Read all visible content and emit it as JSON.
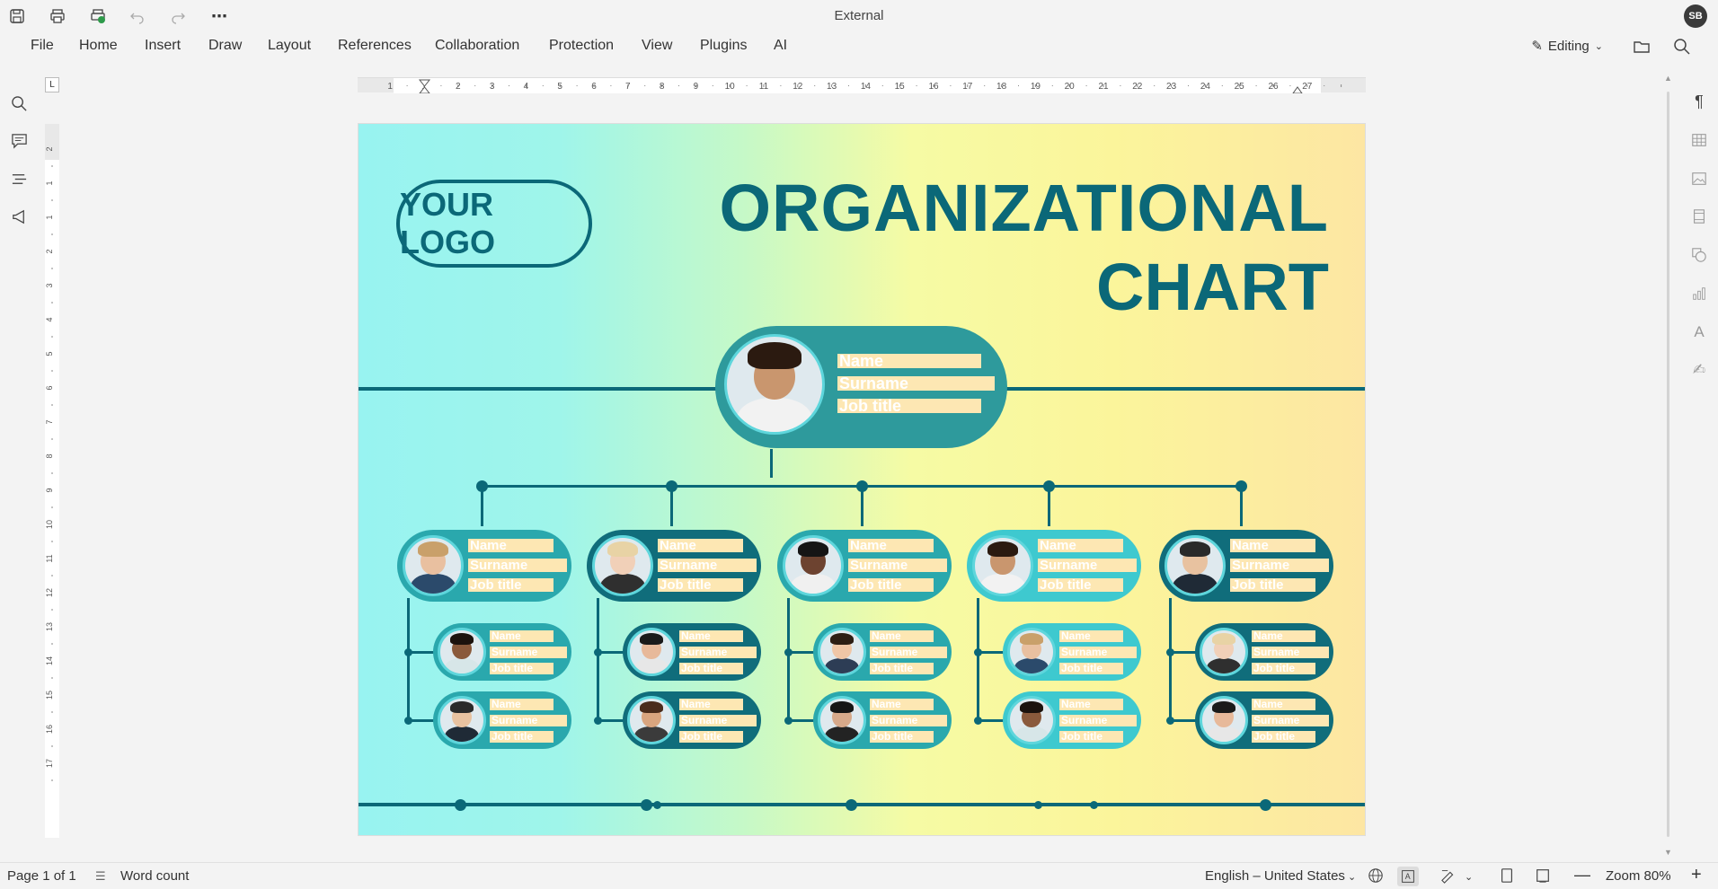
{
  "window": {
    "title": "External",
    "user_initials": "SB"
  },
  "menu": [
    "File",
    "Home",
    "Insert",
    "Draw",
    "Layout",
    "References",
    "Collaboration",
    "Protection",
    "View",
    "Plugins",
    "AI"
  ],
  "editing_mode": "Editing",
  "ruler": {
    "h_labels": [
      "1",
      "1",
      "2",
      "3",
      "4",
      "5",
      "6",
      "7",
      "8",
      "9",
      "10",
      "11",
      "12",
      "13",
      "14",
      "15",
      "16",
      "17",
      "18",
      "19",
      "20",
      "21",
      "22",
      "23",
      "24",
      "25",
      "26",
      "27"
    ],
    "v_labels": [
      "2",
      "1",
      "1",
      "2",
      "3",
      "4",
      "5",
      "6",
      "7",
      "8",
      "9",
      "10",
      "11",
      "12",
      "13",
      "14",
      "15",
      "16",
      "17"
    ],
    "corner": "L"
  },
  "document": {
    "logo_text": "YOUR LOGO",
    "title_line1": "ORGANIZATIONAL",
    "title_line2": "CHART",
    "placeholder": {
      "name": "Name",
      "surname": "Surname",
      "job": "Job title"
    }
  },
  "status": {
    "page": "Page 1 of 1",
    "word_count": "Word count",
    "language": "English – United States",
    "zoom": "Zoom 80%"
  },
  "colors": {
    "accent": "#0b6878",
    "teal": "#2e9a9c",
    "field": "#fde7b3"
  }
}
